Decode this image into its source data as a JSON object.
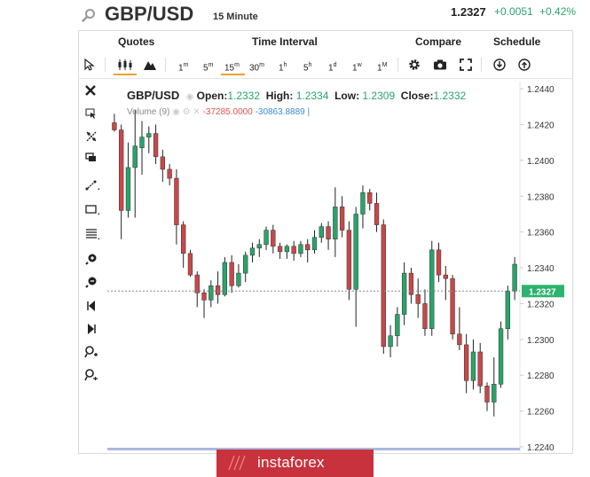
{
  "header": {
    "symbol": "GBP/USD",
    "interval": "15 Minute",
    "price": "1.2327",
    "change": "+0.0051",
    "change_pct": "+0.42%"
  },
  "menu": [
    "Quotes",
    "Time Interval",
    "Compare",
    "Schedule"
  ],
  "toolbar": {
    "intervals": [
      {
        "n": "1",
        "u": "m"
      },
      {
        "n": "5",
        "u": "m"
      },
      {
        "n": "15",
        "u": "m"
      },
      {
        "n": "30",
        "u": "m"
      },
      {
        "n": "1",
        "u": "h"
      },
      {
        "n": "5",
        "u": "h"
      },
      {
        "n": "1",
        "u": "d"
      },
      {
        "n": "1",
        "u": "w"
      },
      {
        "n": "1",
        "u": "M"
      }
    ],
    "active_interval": "15m"
  },
  "legend": {
    "symbol": "GBP/USD",
    "open_label": "Open:",
    "open": "1.2332",
    "high_label": "High:",
    "high": "1.2334",
    "low_label": "Low:",
    "low": "1.2309",
    "close_label": "Close:",
    "close": "1.2332",
    "volume_label": "Volume",
    "volume_period": "(9)",
    "volume_neg": "-37285.0000",
    "volume_pos": "-30863.8889"
  },
  "price_tag": "1.2327",
  "logo": "instaforex",
  "colors": {
    "up": "#2aa36b",
    "down": "#c8474a",
    "tag": "#2db36f",
    "brand": "#c8323c",
    "volume_neg": "#e0534a",
    "volume_pos": "#3b8bd6"
  },
  "chart_data": {
    "type": "candlestick",
    "y_ticks": [
      "1.2440",
      "1.2420",
      "1.2400",
      "1.2380",
      "1.2360",
      "1.2340",
      "1.2320",
      "1.2300",
      "1.2280",
      "1.2260",
      "1.2240"
    ],
    "ylim": [
      1.224,
      1.2444
    ],
    "current": 1.2327,
    "candles": [
      [
        1.2421,
        1.2426,
        1.2416,
        1.2417
      ],
      [
        1.2417,
        1.242,
        1.2356,
        1.2372
      ],
      [
        1.2372,
        1.241,
        1.2368,
        1.2396
      ],
      [
        1.2396,
        1.2428,
        1.2368,
        1.2408
      ],
      [
        1.2407,
        1.2422,
        1.2392,
        1.2413
      ],
      [
        1.2413,
        1.2419,
        1.2404,
        1.2415
      ],
      [
        1.2415,
        1.242,
        1.2398,
        1.2402
      ],
      [
        1.2402,
        1.2406,
        1.2388,
        1.2395
      ],
      [
        1.2395,
        1.2398,
        1.2386,
        1.239
      ],
      [
        1.239,
        1.2395,
        1.2353,
        1.2364
      ],
      [
        1.2364,
        1.2366,
        1.234,
        1.2348
      ],
      [
        1.2348,
        1.235,
        1.2335,
        1.2336
      ],
      [
        1.2336,
        1.2338,
        1.2318,
        1.2326
      ],
      [
        1.2326,
        1.2328,
        1.2312,
        1.2322
      ],
      [
        1.2322,
        1.2333,
        1.2318,
        1.233
      ],
      [
        1.233,
        1.2338,
        1.232,
        1.2325
      ],
      [
        1.2325,
        1.2346,
        1.2324,
        1.2343
      ],
      [
        1.2343,
        1.2347,
        1.2326,
        1.233
      ],
      [
        1.233,
        1.2342,
        1.2329,
        1.2337
      ],
      [
        1.2337,
        1.2349,
        1.2332,
        1.2347
      ],
      [
        1.2347,
        1.2354,
        1.2343,
        1.2351
      ],
      [
        1.2351,
        1.2356,
        1.2346,
        1.2353
      ],
      [
        1.2353,
        1.2363,
        1.235,
        1.2361
      ],
      [
        1.2361,
        1.2364,
        1.2348,
        1.2352
      ],
      [
        1.2352,
        1.2354,
        1.2345,
        1.2349
      ],
      [
        1.2349,
        1.2353,
        1.2345,
        1.2352
      ],
      [
        1.2352,
        1.2355,
        1.2344,
        1.2348
      ],
      [
        1.2348,
        1.2355,
        1.2346,
        1.2353
      ],
      [
        1.2353,
        1.2356,
        1.2343,
        1.235
      ],
      [
        1.235,
        1.2361,
        1.2348,
        1.2357
      ],
      [
        1.2357,
        1.2365,
        1.2354,
        1.2363
      ],
      [
        1.2363,
        1.2366,
        1.235,
        1.2356
      ],
      [
        1.2356,
        1.2385,
        1.2346,
        1.2374
      ],
      [
        1.2374,
        1.238,
        1.2357,
        1.2361
      ],
      [
        1.2361,
        1.2366,
        1.2322,
        1.2328
      ],
      [
        1.2328,
        1.2374,
        1.2307,
        1.237
      ],
      [
        1.237,
        1.2386,
        1.2362,
        1.2382
      ],
      [
        1.2382,
        1.2384,
        1.2372,
        1.2376
      ],
      [
        1.2376,
        1.2382,
        1.236,
        1.2364
      ],
      [
        1.2364,
        1.2367,
        1.2292,
        1.2296
      ],
      [
        1.2296,
        1.2308,
        1.229,
        1.2302
      ],
      [
        1.2302,
        1.2318,
        1.2296,
        1.2314
      ],
      [
        1.2314,
        1.2343,
        1.2308,
        1.2337
      ],
      [
        1.2337,
        1.234,
        1.232,
        1.2325
      ],
      [
        1.2325,
        1.2334,
        1.2312,
        1.232
      ],
      [
        1.232,
        1.2328,
        1.2302,
        1.2306
      ],
      [
        1.2306,
        1.2355,
        1.2302,
        1.235
      ],
      [
        1.235,
        1.2354,
        1.2332,
        1.2336
      ],
      [
        1.2336,
        1.2341,
        1.2322,
        1.2334
      ],
      [
        1.2334,
        1.2336,
        1.23,
        1.2303
      ],
      [
        1.2303,
        1.2318,
        1.2294,
        1.2297
      ],
      [
        1.2297,
        1.2303,
        1.227,
        1.2277
      ],
      [
        1.2277,
        1.23,
        1.2272,
        1.2293
      ],
      [
        1.2293,
        1.2298,
        1.227,
        1.2274
      ],
      [
        1.2274,
        1.2276,
        1.226,
        1.2265
      ],
      [
        1.2265,
        1.229,
        1.2257,
        1.2275
      ],
      [
        1.2275,
        1.231,
        1.2273,
        1.2306
      ],
      [
        1.2306,
        1.233,
        1.23,
        1.2327
      ],
      [
        1.2327,
        1.2346,
        1.2322,
        1.2342
      ]
    ]
  }
}
